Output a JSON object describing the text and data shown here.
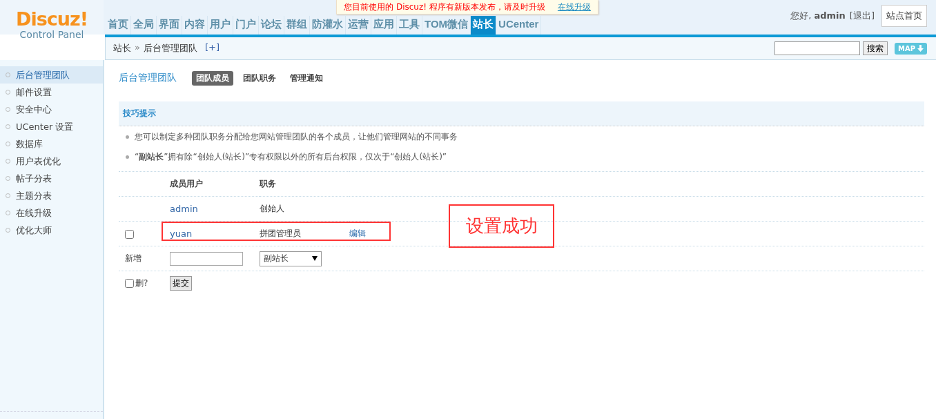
{
  "notice": {
    "text": "您目前使用的 Discuz! 程序有新版本发布，请及时升级",
    "link": "在线升级"
  },
  "logo": {
    "brand": "Discuz!",
    "subtitle": "Control Panel"
  },
  "nav": [
    {
      "label": "首页",
      "selected": false
    },
    {
      "label": "全局",
      "selected": false
    },
    {
      "label": "界面",
      "selected": false
    },
    {
      "label": "内容",
      "selected": false
    },
    {
      "label": "用户",
      "selected": false
    },
    {
      "label": "门户",
      "selected": false
    },
    {
      "label": "论坛",
      "selected": false
    },
    {
      "label": "群组",
      "selected": false
    },
    {
      "label": "防灌水",
      "selected": false
    },
    {
      "label": "运营",
      "selected": false
    },
    {
      "label": "应用",
      "selected": false
    },
    {
      "label": "工具",
      "selected": false
    },
    {
      "label": "TOM微信",
      "selected": false
    },
    {
      "label": "站长",
      "selected": true
    },
    {
      "label": "UCenter",
      "selected": false
    }
  ],
  "user": {
    "greeting": "您好,",
    "name": "admin",
    "logout": "[退出]",
    "home_button": "站点首页"
  },
  "breadcrumb": {
    "items": [
      "站长",
      "后台管理团队"
    ],
    "separator": "»",
    "add": "[+]"
  },
  "search": {
    "button": "搜索",
    "map_button": "MAP"
  },
  "sidebar": {
    "items": [
      {
        "label": "后台管理团队",
        "selected": true
      },
      {
        "label": "邮件设置",
        "selected": false
      },
      {
        "label": "安全中心",
        "selected": false
      },
      {
        "label": "UCenter 设置",
        "selected": false
      },
      {
        "label": "数据库",
        "selected": false
      },
      {
        "label": "用户表优化",
        "selected": false
      },
      {
        "label": "帖子分表",
        "selected": false
      },
      {
        "label": "主题分表",
        "selected": false
      },
      {
        "label": "在线升级",
        "selected": false
      },
      {
        "label": "优化大师",
        "selected": false
      }
    ]
  },
  "page": {
    "title": "后台管理团队",
    "tabs": [
      {
        "label": "团队成员",
        "selected": true
      },
      {
        "label": "团队职务",
        "selected": false
      },
      {
        "label": "管理通知",
        "selected": false
      }
    ]
  },
  "tips": {
    "title": "技巧提示",
    "items": [
      "您可以制定多种团队职务分配给您网站管理团队的各个成员，让他们管理网站的不同事务",
      "“**副站长**”拥有除“创始人(站长)”专有权限以外的所有后台权限，仅次于“创始人(站长)”"
    ]
  },
  "table": {
    "columns": [
      "成员用户",
      "职务"
    ],
    "rows": [
      {
        "kind": "founder",
        "user": "admin",
        "role": "创始人"
      },
      {
        "kind": "member",
        "user": "yuan",
        "role": "拼团管理员",
        "checked": false,
        "edit": "编辑",
        "highlighted": true
      }
    ]
  },
  "add_row": {
    "label": "新增",
    "role_select": "副站长"
  },
  "footer_row": {
    "delete_label": "删?",
    "delete_checked": false,
    "submit": "提交"
  },
  "annotation": {
    "text": "设置成功"
  }
}
